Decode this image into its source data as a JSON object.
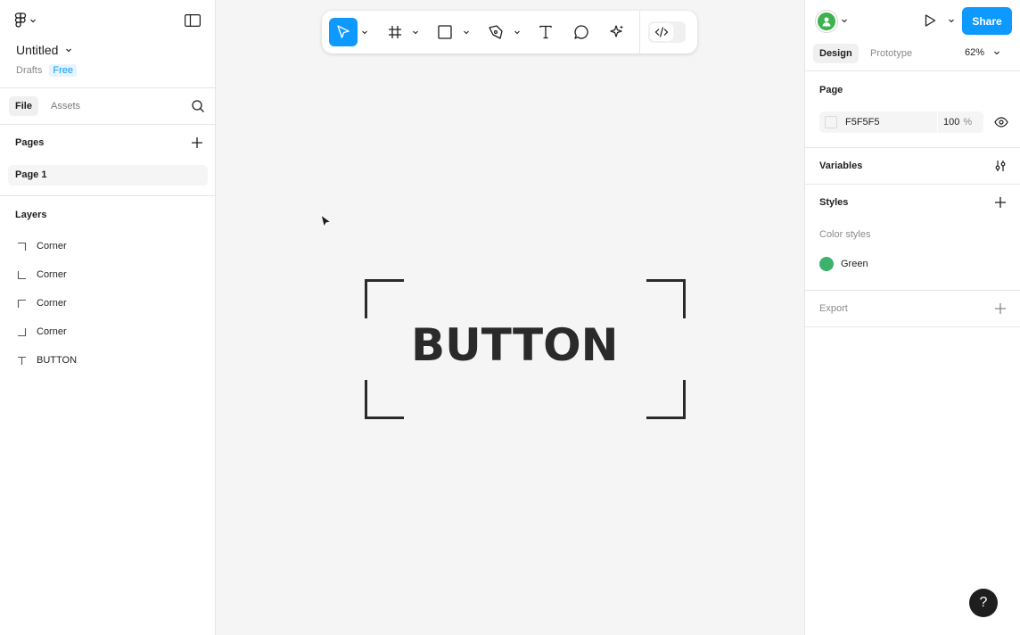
{
  "file": {
    "title": "Untitled",
    "location": "Drafts",
    "plan_badge": "Free"
  },
  "left_tabs": {
    "file": "File",
    "assets": "Assets"
  },
  "pages": {
    "heading": "Pages",
    "items": [
      {
        "label": "Page 1"
      }
    ]
  },
  "layers": {
    "heading": "Layers",
    "items": [
      {
        "label": "Corner",
        "icon": "corner-top-right-icon"
      },
      {
        "label": "Corner",
        "icon": "corner-bottom-left-icon"
      },
      {
        "label": "Corner",
        "icon": "corner-top-left-icon"
      },
      {
        "label": "Corner",
        "icon": "corner-bottom-right-icon"
      },
      {
        "label": "BUTTON",
        "icon": "text-icon"
      }
    ]
  },
  "canvas": {
    "button_text": "BUTTON"
  },
  "toolbar": {
    "tools": [
      "move-tool",
      "frame-tool",
      "shape-tool",
      "pen-tool",
      "text-tool",
      "comment-tool",
      "actions-tool",
      "dev-mode-toggle"
    ],
    "accent": "#0d99ff"
  },
  "right_header": {
    "share_label": "Share",
    "tab_design": "Design",
    "tab_prototype": "Prototype",
    "zoom": "62%"
  },
  "page_section": {
    "heading": "Page",
    "color_hex": "F5F5F5",
    "opacity": "100",
    "opacity_unit": "%"
  },
  "variables": {
    "heading": "Variables"
  },
  "styles": {
    "heading": "Styles",
    "subheading": "Color styles",
    "items": [
      {
        "label": "Green",
        "color": "#3cb26a"
      }
    ]
  },
  "export": {
    "heading": "Export"
  },
  "help": {
    "label": "?"
  }
}
